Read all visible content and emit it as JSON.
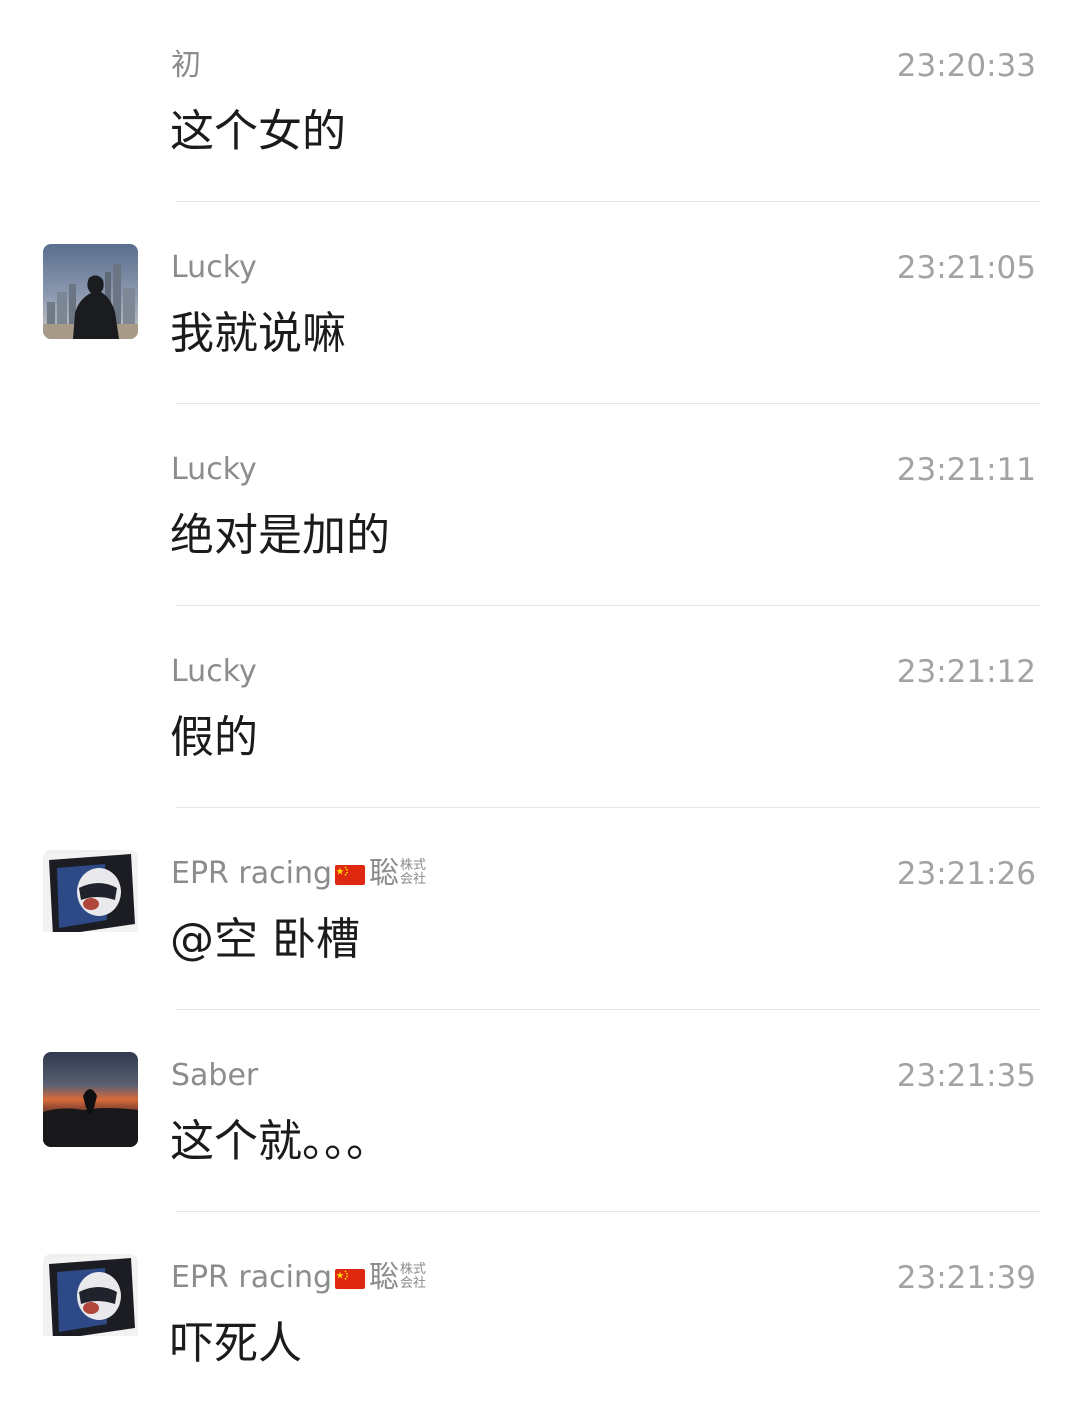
{
  "messages": [
    {
      "sender": "初",
      "time": "23:20:33",
      "text": "这个女的",
      "avatar": null
    },
    {
      "sender": "Lucky",
      "time": "23:21:05",
      "text": "我就说嘛",
      "avatar": "city-silhouette"
    },
    {
      "sender": "Lucky",
      "time": "23:21:11",
      "text": "绝对是加的",
      "avatar": null
    },
    {
      "sender": "Lucky",
      "time": "23:21:12",
      "text": "假的",
      "avatar": null
    },
    {
      "sender": "EPR racing",
      "sender_suffix_main": "聡",
      "sender_suffix_small_top": "株式",
      "sender_suffix_small_bottom": "会社",
      "time": "23:21:26",
      "text": "@空 卧槽",
      "avatar": "racing-helmet"
    },
    {
      "sender": "Saber",
      "time": "23:21:35",
      "text": "这个就。。。",
      "avatar": "sunset-silhouette"
    },
    {
      "sender": "EPR racing",
      "sender_suffix_main": "聡",
      "sender_suffix_small_top": "株式",
      "sender_suffix_small_bottom": "会社",
      "time": "23:21:39",
      "text": "吓死人",
      "avatar": "racing-helmet"
    }
  ],
  "colors": {
    "name": "#8c8c8c",
    "time": "#a3a3a3",
    "text": "#1b1b1b",
    "divider": "#e6e6e6",
    "flag_red": "#de2910",
    "flag_yellow": "#ffde00"
  }
}
